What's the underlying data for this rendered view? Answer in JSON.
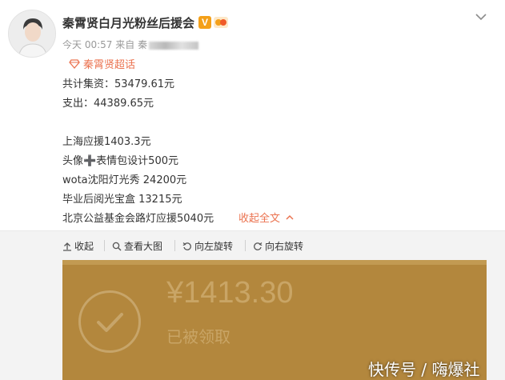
{
  "post": {
    "username": "秦霄贤白月光粉丝后援会",
    "verified_badge": "V",
    "timestamp": "今天 00:57",
    "source_prefix": "来自",
    "source_visible": "秦",
    "supertopic": "秦霄贤超话",
    "lines": [
      "共计集资：53479.61元",
      "支出：44389.65元",
      "上海应援1403.3元",
      "头像➕表情包设计500元",
      "wota沈阳灯光秀 24200元",
      "毕业后阅光宝盒 13215元",
      "北京公益基金会路灯应援5040元"
    ],
    "collapse_label": "收起全文"
  },
  "toolbar": {
    "collapse": "收起",
    "view_large": "查看大图",
    "rotate_left": "向左旋转",
    "rotate_right": "向右旋转"
  },
  "photo": {
    "amount": "¥1413.30",
    "status": "已被领取"
  },
  "watermark": "快传号 / 嗨爆社",
  "icons": {
    "chevron": "chevron-down-icon",
    "supertopic": "diamond-icon",
    "collapse_arrow": "chevron-up-icon",
    "toolbar_collapse": "arrow-up-icon",
    "view_large": "magnifier-icon",
    "rotate_left": "rotate-left-icon",
    "rotate_right": "rotate-right-icon",
    "check": "check-circle-icon"
  },
  "colors": {
    "accent": "#eb7350",
    "verified": "#f4a019",
    "photo_bg": "#b3873d"
  }
}
